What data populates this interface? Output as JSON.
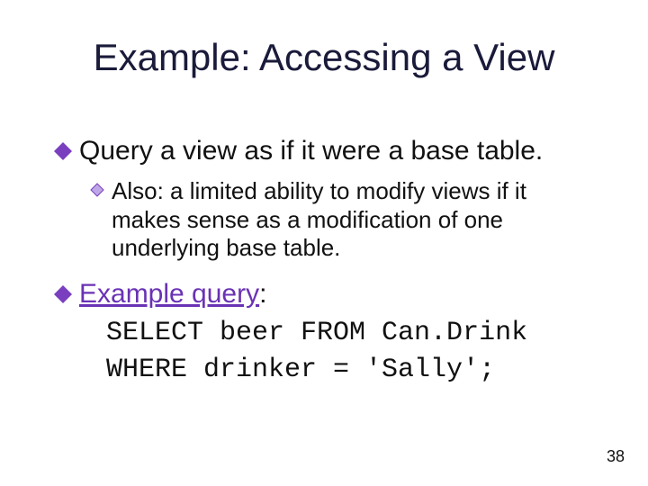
{
  "title": "Example: Accessing a View",
  "bullets": {
    "b1": "Query a view as if it were a base table.",
    "b1_sub": "Also: a limited ability to modify views if it makes sense as a modification of one underlying base table.",
    "b2_lead": "Example query",
    "b2_colon": ":"
  },
  "code": {
    "line1": "SELECT beer FROM Can.Drink",
    "line2": "WHERE drinker = 'Sally';"
  },
  "page_number": "38"
}
